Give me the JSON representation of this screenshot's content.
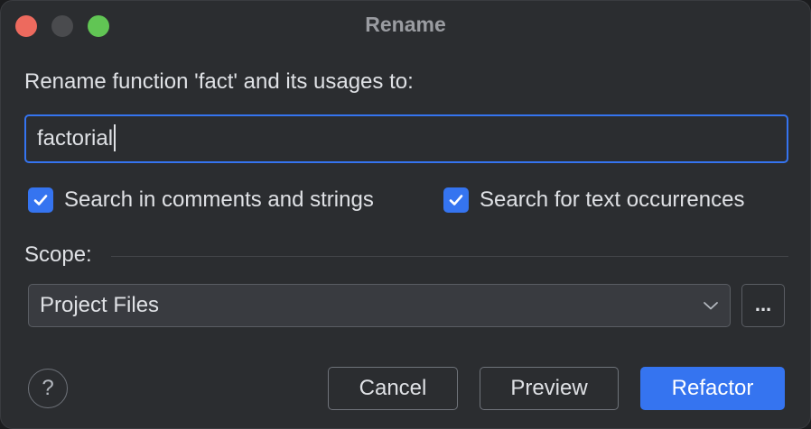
{
  "window": {
    "title": "Rename"
  },
  "dialog": {
    "prompt": "Rename function 'fact' and its usages to:",
    "new_name_value": "factorial",
    "options": [
      {
        "label": "Search in comments and strings",
        "checked": true
      },
      {
        "label": "Search for text occurrences",
        "checked": true
      }
    ],
    "scope": {
      "label": "Scope:",
      "selected": "Project Files",
      "more_label": "..."
    }
  },
  "buttons": {
    "help_label": "?",
    "cancel_label": "Cancel",
    "preview_label": "Preview",
    "refactor_label": "Refactor"
  },
  "colors": {
    "accent": "#3574f0",
    "background": "#2b2d30",
    "close": "#ed6a5e",
    "minimize": "#4a4b4e",
    "zoom": "#61c554"
  }
}
